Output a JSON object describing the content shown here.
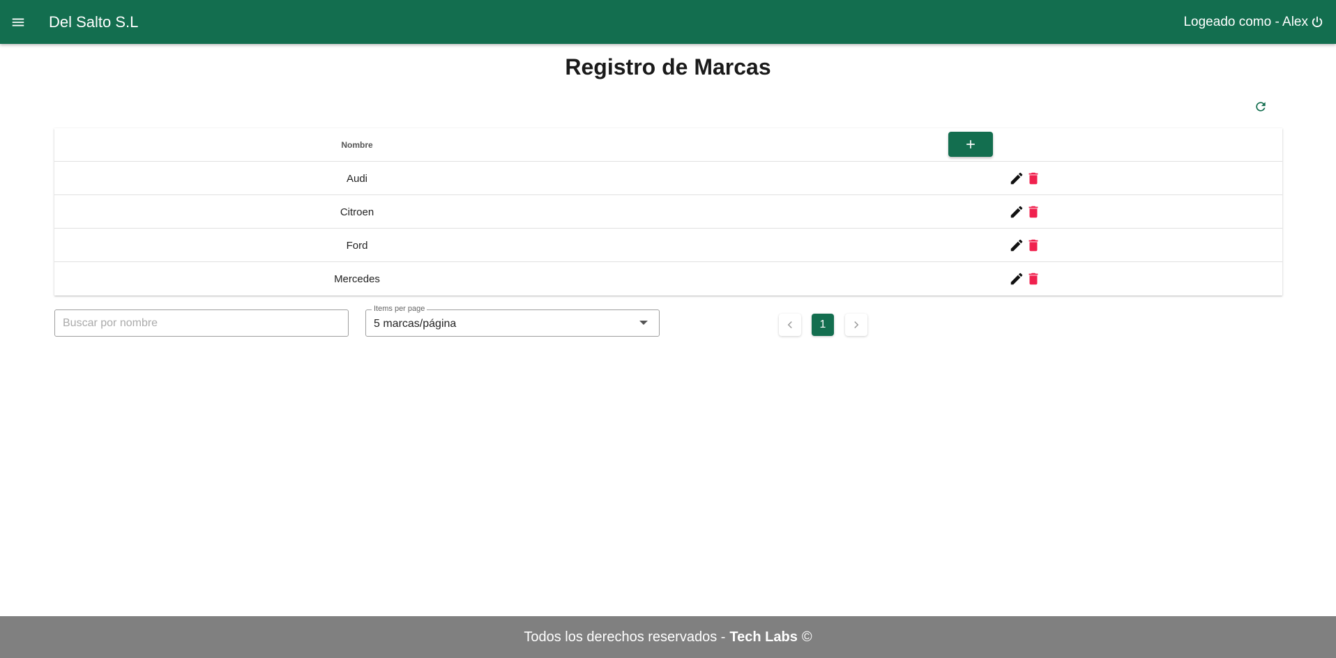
{
  "header": {
    "app_title": "Del Salto S.L",
    "user_label": "Logeado como - Alex",
    "menu_icon": "menu-icon",
    "power_icon": "power-icon",
    "bar_color": "#136e4f"
  },
  "main": {
    "title": "Registro de Marcas",
    "refresh_icon": "refresh-icon"
  },
  "table": {
    "column_header": "Nombre",
    "add_icon": "plus-icon",
    "rows": [
      {
        "name": "Audi"
      },
      {
        "name": "Citroen"
      },
      {
        "name": "Ford"
      },
      {
        "name": "Mercedes"
      }
    ],
    "edit_icon": "pencil-icon",
    "delete_icon": "trash-icon",
    "delete_color": "#f0214e"
  },
  "filters": {
    "search_placeholder": "Buscar por nombre",
    "search_value": "",
    "items_per_page_label": "Items per page",
    "items_per_page_value": "5 marcas/página"
  },
  "pagination": {
    "current_page": "1",
    "prev_icon": "chevron-left-icon",
    "next_icon": "chevron-right-icon"
  },
  "footer": {
    "text": "Todos los derechos reservados -",
    "brand": "Tech Labs",
    "symbol": "©",
    "color": "#808080"
  }
}
